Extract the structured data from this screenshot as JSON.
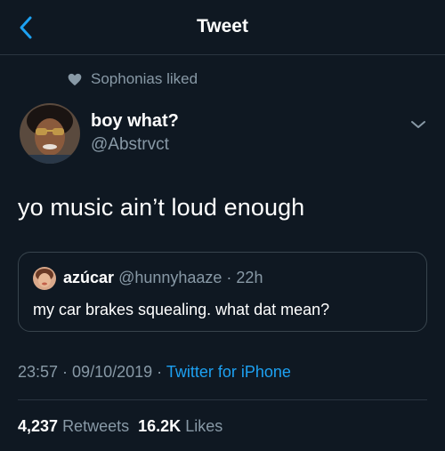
{
  "header": {
    "title": "Tweet"
  },
  "social_context": {
    "text": "Sophonias liked"
  },
  "author": {
    "name": "boy what?",
    "handle": "@Abstrvct"
  },
  "tweet": {
    "text": "yo music ain’t loud enough",
    "time": "23:57",
    "date": "09/10/2019",
    "source": "Twitter for iPhone",
    "separator": " · "
  },
  "quote": {
    "name": "azúcar",
    "handle": "@hunnyhaaze",
    "time": "22h",
    "separator": " · ",
    "text": "my car brakes squealing. what dat mean?"
  },
  "stats": {
    "retweets_count": "4,237",
    "retweets_label": "Retweets",
    "likes_count": "16.2K",
    "likes_label": "Likes"
  },
  "colors": {
    "background": "#0f1822",
    "accent": "#1da1f2",
    "secondary_text": "#8899a6",
    "border": "#38444d"
  }
}
